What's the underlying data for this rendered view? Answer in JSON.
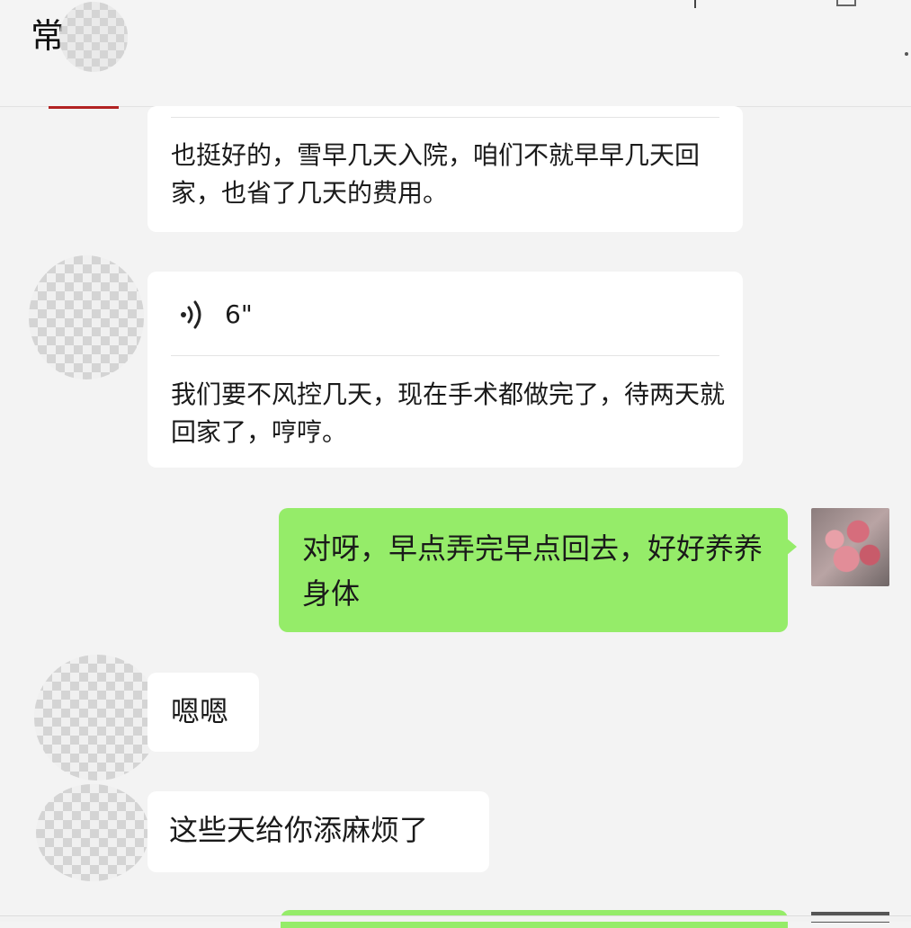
{
  "header": {
    "title": "常"
  },
  "messages": {
    "m1_text": "也挺好的，雪早几天入院，咱们不就早早几天回家，也省了几天的费用。",
    "m2_voice_duration": "6\"",
    "m2_text": "我们要不风控几天，现在手术都做完了，待两天就回家了，哼哼。",
    "m3_text": "对呀，早点弄完早点回去，好好养养身体",
    "m4_text": "嗯嗯",
    "m5_text": "这些天给你添麻烦了"
  },
  "icons": {
    "voice": "voice-wave-icon"
  },
  "colors": {
    "my_bubble": "#95ec69",
    "their_bubble": "#ffffff",
    "background": "#f3f3f3"
  }
}
